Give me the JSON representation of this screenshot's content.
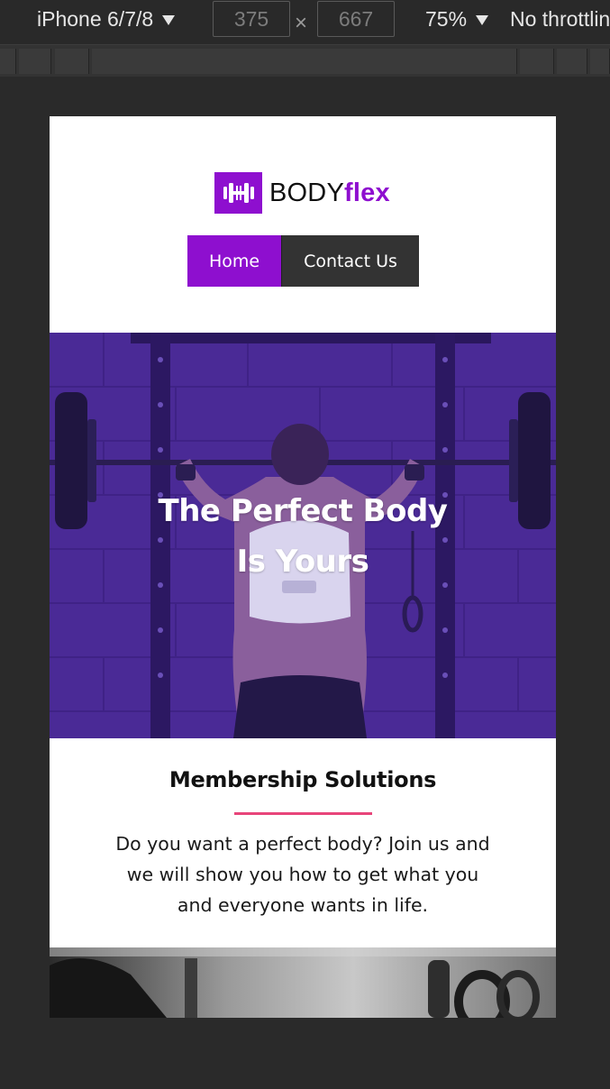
{
  "devtools": {
    "device": "iPhone 6/7/8",
    "width": "375",
    "times": "×",
    "height": "667",
    "zoom": "75%",
    "throttling": "No throttling"
  },
  "site": {
    "logo": {
      "word1": "BODY",
      "word2": "flex"
    },
    "nav": {
      "home": "Home",
      "contact": "Contact Us"
    },
    "hero": {
      "line1": "The Perfect Body",
      "line2": "Is Yours"
    },
    "membership": {
      "heading": "Membership Solutions",
      "body": "Do you want a perfect body? Join us and we will show you how to get what you and everyone wants in life."
    }
  },
  "colors": {
    "brand": "#8e0fcf",
    "nav_dark": "#333333",
    "accent_underline": "#e8457a",
    "hero_overlay": "#4b2a9a"
  }
}
